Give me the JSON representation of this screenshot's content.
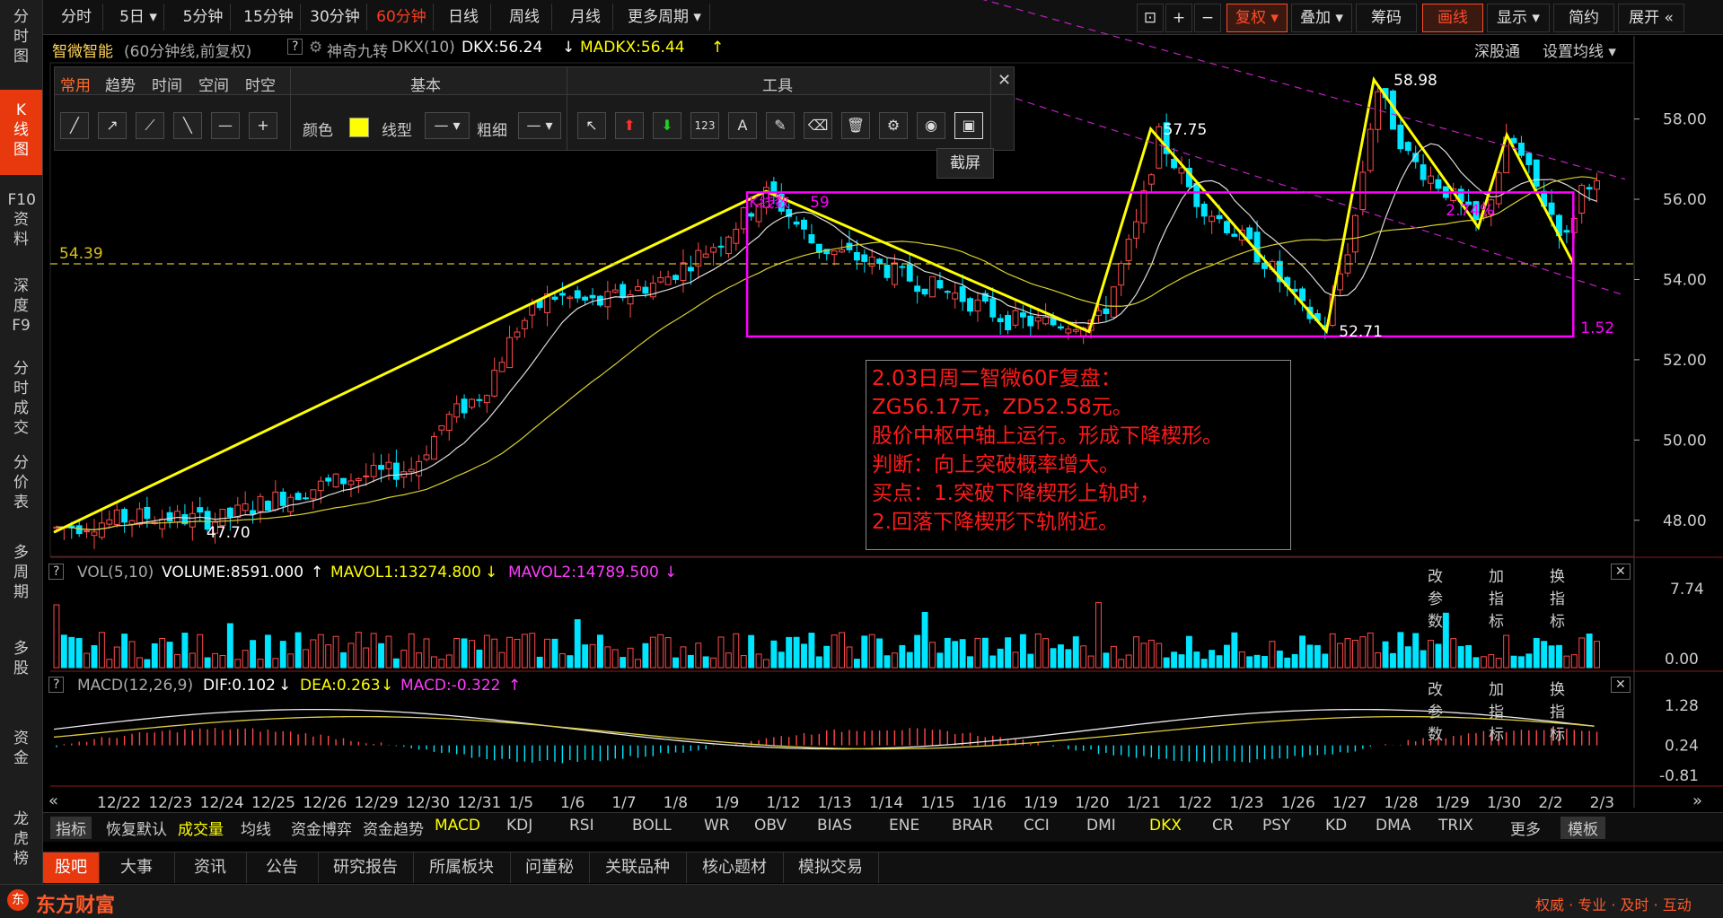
{
  "sidebar": {
    "items": [
      {
        "label": "分时图"
      },
      {
        "label": "K线图"
      },
      {
        "label": "F10资料"
      },
      {
        "label": "深度F9"
      },
      {
        "label": "分时成交"
      },
      {
        "label": "分价表"
      },
      {
        "label": "多周期"
      },
      {
        "label": "多股"
      },
      {
        "label": "资金"
      },
      {
        "label": "龙虎榜"
      }
    ]
  },
  "period_bar": {
    "items": [
      "分时",
      "5日 ▾",
      "5分钟",
      "15分钟",
      "30分钟",
      "60分钟",
      "日线",
      "周线",
      "月线",
      "更多周期 ▾"
    ],
    "active": "60分钟",
    "right": [
      "复权 ▾",
      "叠加 ▾",
      "筹码",
      "画线",
      "显示 ▾",
      "简约",
      "展开 «"
    ]
  },
  "info": {
    "name": "智微智能",
    "period": "(60分钟线,前复权)",
    "help": "?",
    "indicator_name": "神奇九转",
    "dkx_label": "DKX(10)",
    "dkx_value": "DKX:56.24",
    "dkx_arrow": "↓",
    "madkx_value": "MADKX:56.44",
    "madkx_arrow": "↑",
    "right1": "深股通",
    "right2": "设置均线 ▾"
  },
  "tool_panel": {
    "tabs": [
      "常用",
      "趋势",
      "时间",
      "空间",
      "时空"
    ],
    "active_tab": "常用",
    "section_basic": "基本",
    "section_tools": "工具",
    "color_label": "颜色",
    "line_type_label": "线型",
    "thickness_label": "粗细",
    "tooltip": "截屏",
    "color_swatch": "#ffff00"
  },
  "price_axis": [
    "58.00",
    "56.00",
    "54.00",
    "52.00",
    "50.00",
    "48.00"
  ],
  "price_labels": {
    "hline": "54.39",
    "high1": "58.98",
    "high2": "57.75",
    "low1": "47.70",
    "low2": "52.71",
    "pct": "2.74%",
    "box_right": "1.52",
    "box_label": "K线数",
    "box_count": "59"
  },
  "annotation": {
    "lines": [
      "2.03日周二智微60F复盘：",
      "ZG56.17元，ZD52.58元。",
      "股价中枢中轴上运行。形成下降楔形。",
      "判断：向上突破概率增大。",
      "买点：1.突破下降楔形上轨时，",
      "2.回落下降楔形下轨附近。"
    ]
  },
  "volume_panel": {
    "title": "VOL(5,10)",
    "volume": "VOLUME:8591.000",
    "volume_arrow": "↑",
    "mavol1": "MAVOL1:13274.800",
    "mavol1_arrow": "↓",
    "mavol2": "MAVOL2:14789.500",
    "mavol2_arrow": "↓",
    "axis_top": "7.74",
    "axis_bottom": "0.00",
    "actions": [
      "改参数",
      "加指标",
      "换指标"
    ]
  },
  "macd_panel": {
    "title": "MACD(12,26,9)",
    "dif": "DIF:0.102",
    "dif_arrow": "↓",
    "dea": "DEA:0.263",
    "dea_arrow": "↓",
    "macd": "MACD:-0.322",
    "macd_arrow": "↑",
    "axis": [
      "1.28",
      "0.24",
      "-0.81"
    ],
    "actions": [
      "改参数",
      "加指标",
      "换指标"
    ]
  },
  "date_axis": [
    "12/22",
    "12/23",
    "12/24",
    "12/25",
    "12/26",
    "12/29",
    "12/30",
    "12/31",
    "1/5",
    "1/6",
    "1/7",
    "1/8",
    "1/9",
    "1/12",
    "1/13",
    "1/14",
    "1/15",
    "1/16",
    "1/19",
    "1/20",
    "1/21",
    "1/22",
    "1/23",
    "1/26",
    "1/27",
    "1/28",
    "1/29",
    "1/30",
    "2/2",
    "2/3"
  ],
  "indicator_tabs": [
    "指标",
    "恢复默认",
    "成交量",
    "均线",
    "资金博弈",
    "资金趋势",
    "MACD",
    "KDJ",
    "RSI",
    "BOLL",
    "WR",
    "OBV",
    "BIAS",
    "ENE",
    "BRAR",
    "CCI",
    "DMI",
    "DKX",
    "CR",
    "PSY",
    "KD",
    "DMA",
    "TRIX",
    "更多",
    "模板"
  ],
  "info_tabs": [
    "股吧",
    "大事",
    "资讯",
    "公告",
    "研究报告",
    "所属板块",
    "问董秘",
    "关联品种",
    "核心题材",
    "模拟交易"
  ],
  "footer": {
    "brand": "东方财富",
    "slogan": "权威 · 专业 · 及时 · 互动"
  },
  "colors": {
    "up": "#ff4a4a",
    "down": "#00e5ff",
    "trend": "#ffff00",
    "box": "#ff00ff",
    "accent": "#e8380d"
  }
}
